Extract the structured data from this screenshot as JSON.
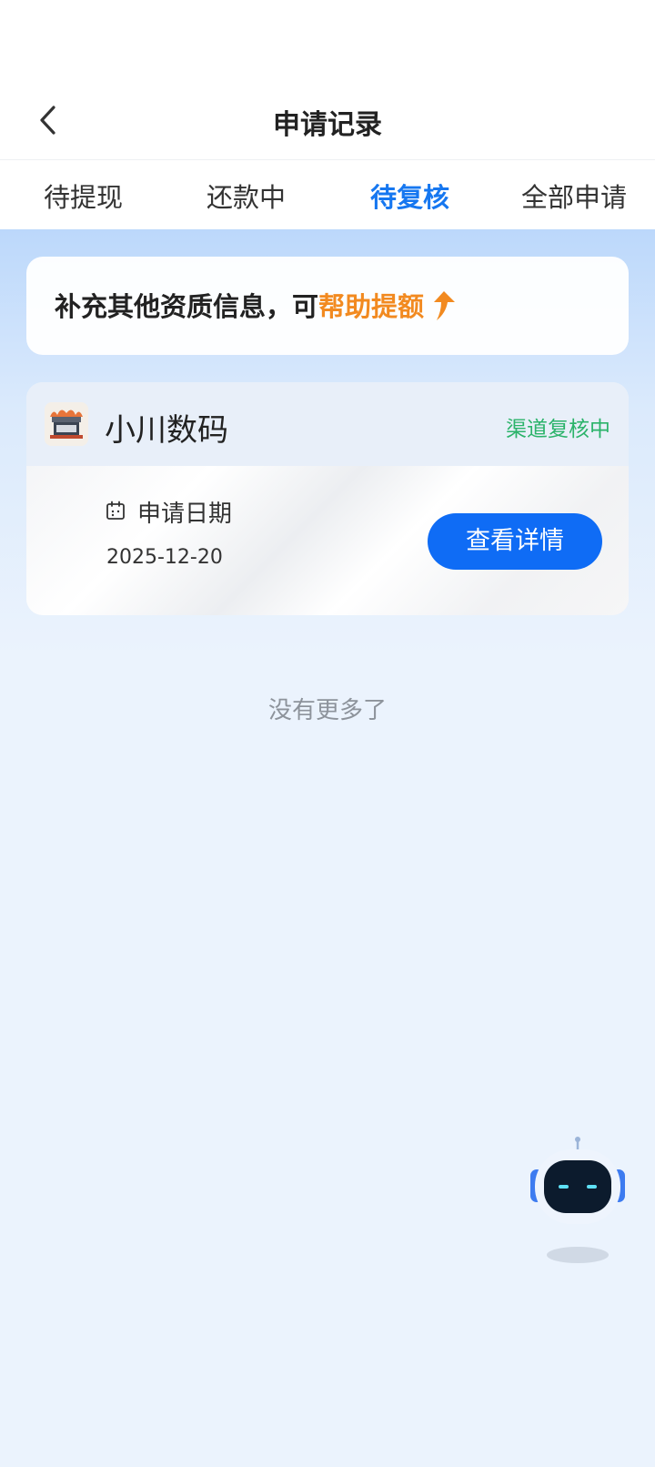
{
  "header": {
    "title": "申请记录",
    "back_icon": "chevron-left-icon"
  },
  "tabs": [
    {
      "label": "待提现",
      "active": false
    },
    {
      "label": "还款中",
      "active": false
    },
    {
      "label": "待复核",
      "active": true
    },
    {
      "label": "全部申请",
      "active": false
    }
  ],
  "tip": {
    "text": "补充其他资质信息，可",
    "highlight": "帮助提额",
    "icon": "arrow-up-icon"
  },
  "application": {
    "name": "小川数码",
    "status": "渠道复核中",
    "date_label": "申请日期",
    "date_value": "2025-12-20",
    "button_label": "查看详情"
  },
  "footer": {
    "no_more": "没有更多了"
  },
  "colors": {
    "accent": "#1677f0",
    "button": "#0f6cf5",
    "status_green": "#2bb36a",
    "highlight_orange": "#f28a20"
  }
}
